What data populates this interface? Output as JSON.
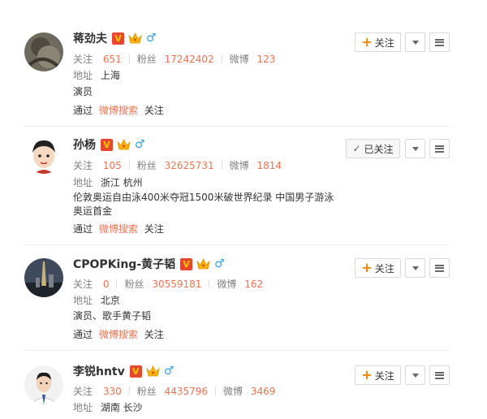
{
  "labels": {
    "follow": "关注",
    "fans": "粉丝",
    "weibo": "微博",
    "location": "地址",
    "via": "通过",
    "via_link": "微博搜索",
    "via_suffix": "关注",
    "follow_btn": "关注",
    "followed_btn": "已关注",
    "plus": "+",
    "check": "✓",
    "v_badge": "V",
    "male": "♂"
  },
  "users": [
    {
      "name": "蒋劲夫",
      "following": "651",
      "fans": "17242402",
      "weibo": "123",
      "location": "上海",
      "bio": "演员",
      "followed": false
    },
    {
      "name": "孙杨",
      "following": "105",
      "fans": "32625731",
      "weibo": "1814",
      "location": "浙江 杭州",
      "bio": "伦敦奥运自由泳400米夺冠1500米破世界纪录 中国男子游泳奥运首金",
      "followed": true
    },
    {
      "name": "CPOPKing-黄子韬",
      "following": "0",
      "fans": "30559181",
      "weibo": "162",
      "location": "北京",
      "bio": "演员、歌手黄子韬",
      "followed": false
    },
    {
      "name": "李锐hntv",
      "following": "330",
      "fans": "4435796",
      "weibo": "3469",
      "location": "湖南 长沙",
      "bio": "",
      "followed": false
    }
  ],
  "colors": {
    "accent": "#eb7350",
    "vbadge": "#e5482d",
    "gender": "#3a9be5",
    "plus": "#ff8200"
  }
}
